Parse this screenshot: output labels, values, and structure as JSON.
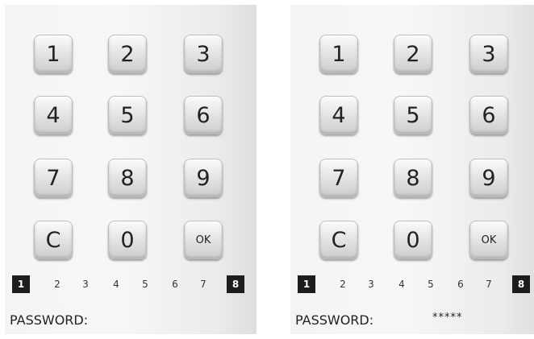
{
  "keypad": {
    "keys": [
      "1",
      "2",
      "3",
      "4",
      "5",
      "6",
      "7",
      "8",
      "9",
      "C",
      "0",
      "OK"
    ]
  },
  "digit_scale": [
    "1",
    "2",
    "3",
    "4",
    "5",
    "6",
    "7",
    "8"
  ],
  "panels": [
    {
      "password_label": "PASSWORD:",
      "password_value": ""
    },
    {
      "password_label": "PASSWORD:",
      "password_value": "*****"
    }
  ],
  "colors": {
    "key_face": "#e6e6e6",
    "active_digit_bg": "#1d1d1d",
    "panel_bg": "#f4f4f4"
  }
}
